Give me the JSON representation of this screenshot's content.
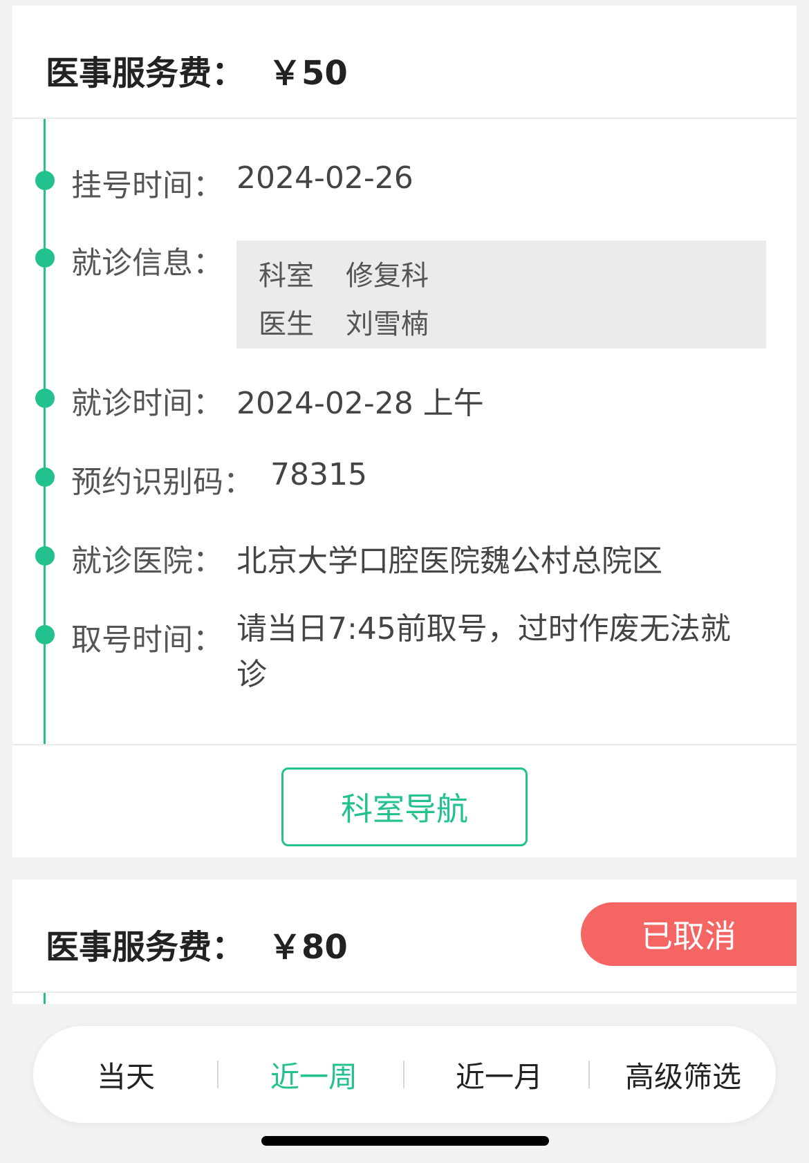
{
  "appointment1": {
    "fee_label": "医事服务费：",
    "fee_amount": "￥50",
    "registered_label": "挂号时间：",
    "registered_value": "2024-02-26",
    "visit_info_label": "就诊信息：",
    "dept_key": "科室",
    "dept_value": "修复科",
    "doctor_key": "医生",
    "doctor_value": "刘雪楠",
    "visit_time_label": "就诊时间：",
    "visit_time_value": "2024-02-28 上午",
    "code_label": "预约识别码：",
    "code_value": "78315",
    "hospital_label": "就诊医院：",
    "hospital_value": "北京大学口腔医院魏公村总院区",
    "pickup_label": "取号时间：",
    "pickup_value": "请当日7:45前取号，过时作废无法就诊",
    "nav_button": "科室导航"
  },
  "appointment2": {
    "fee_label": "医事服务费：",
    "fee_amount": "￥80",
    "status": "已取消"
  },
  "tabs": [
    {
      "label": "当天"
    },
    {
      "label": "近一周"
    },
    {
      "label": "近一月"
    },
    {
      "label": "高级筛选"
    }
  ],
  "active_tab": "近一周",
  "colors": {
    "accent": "#22c18e",
    "cancelled": "#f56563",
    "background": "#f0f2f4"
  }
}
